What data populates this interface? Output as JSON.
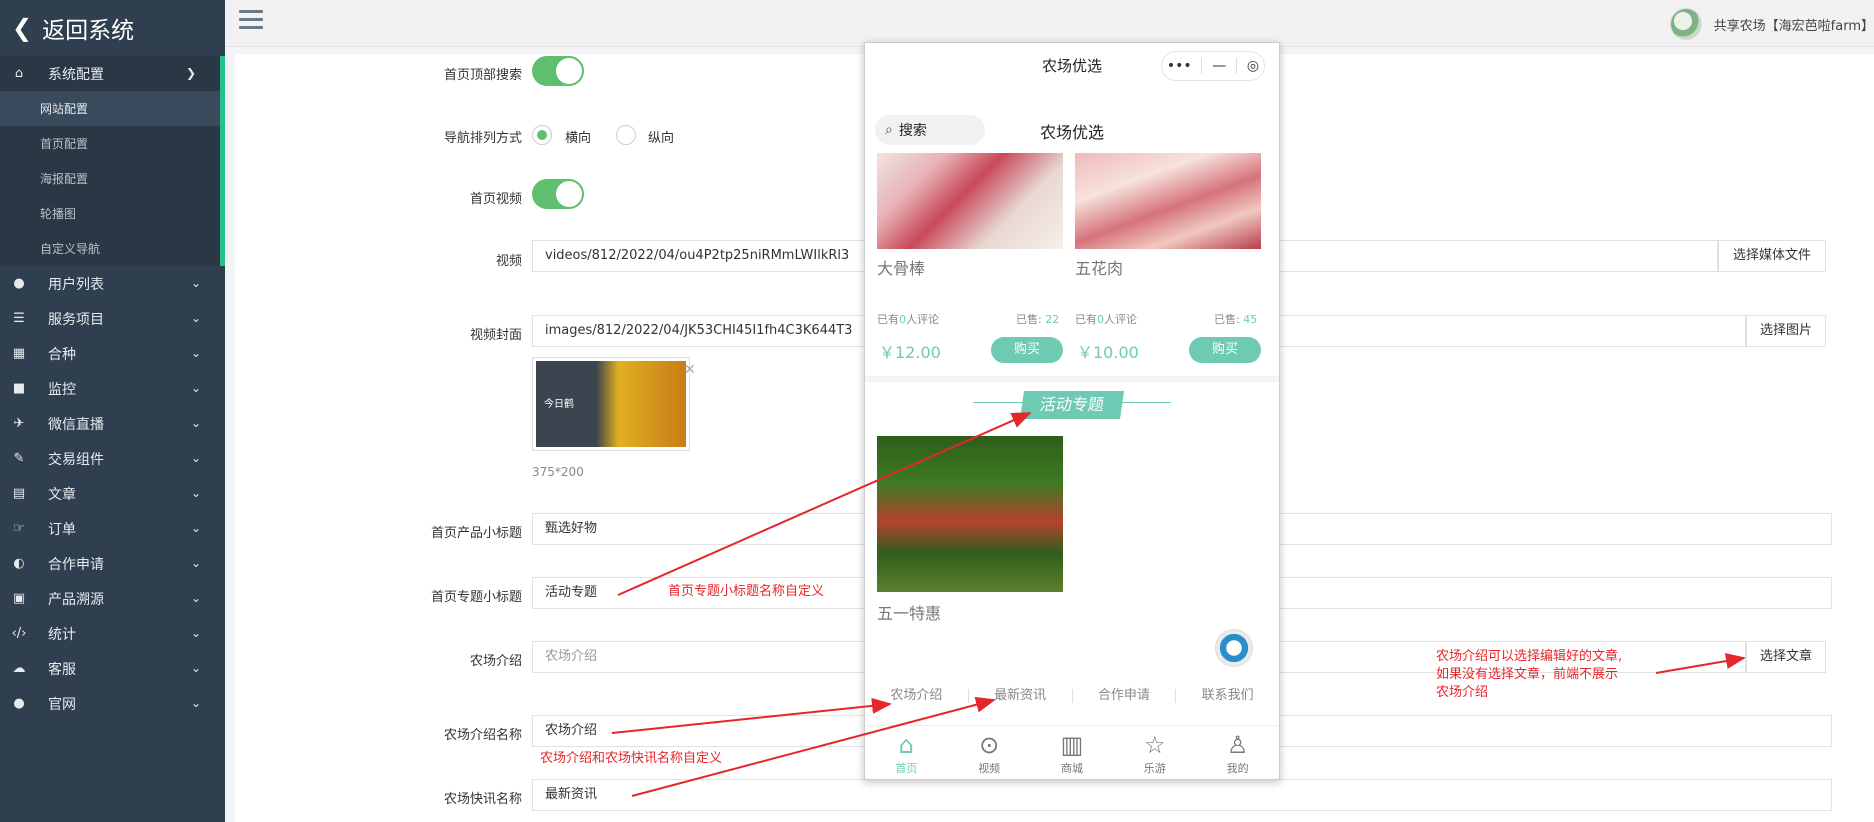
{
  "sidebar": {
    "brand": "返回系统",
    "menu": [
      {
        "label": "系统配置",
        "icon": "⌂"
      },
      {
        "label": "用户列表",
        "icon": "●"
      },
      {
        "label": "服务项目",
        "icon": "☰"
      },
      {
        "label": "合种",
        "icon": "▦"
      },
      {
        "label": "监控",
        "icon": "■"
      },
      {
        "label": "微信直播",
        "icon": "✈"
      },
      {
        "label": "交易组件",
        "icon": "✎"
      },
      {
        "label": "文章",
        "icon": "▤"
      },
      {
        "label": "订单",
        "icon": "☞"
      },
      {
        "label": "合作申请",
        "icon": "◐"
      },
      {
        "label": "产品溯源",
        "icon": "▣"
      },
      {
        "label": "统计",
        "icon": "‹/›"
      },
      {
        "label": "客服",
        "icon": "☁"
      },
      {
        "label": "官网",
        "icon": "●"
      }
    ],
    "submenu": [
      "网站配置",
      "首页配置",
      "海报配置",
      "轮播图",
      "自定义导航"
    ]
  },
  "topbar": {
    "user_name": "共享农场【海宏芭啦farm】"
  },
  "form": {
    "search_label": "首页顶部搜索",
    "nav_label": "导航排列方式",
    "nav_opt_h": "横向",
    "nav_opt_v": "纵向",
    "video_switch_label": "首页视频",
    "video_label": "视频",
    "video_value": "videos/812/2022/04/ou4P2tp25niRMmLWIlkRl3",
    "video_btn": "选择媒体文件",
    "cover_label": "视频封面",
    "cover_value": "images/812/2022/04/JK53CHI45I1fh4C3K644T3",
    "cover_btn": "选择图片",
    "cover_size": "375*200",
    "product_sub_label": "首页产品小标题",
    "product_sub_value": "甄选好物",
    "topic_sub_label": "首页专题小标题",
    "topic_sub_value": "活动专题",
    "farm_intro_label": "农场介绍",
    "farm_intro_placeholder": "农场介绍",
    "farm_intro_btn": "选择文章",
    "farm_intro_name_label": "农场介绍名称",
    "farm_intro_name_value": "农场介绍",
    "farm_news_name_label": "农场快讯名称",
    "farm_news_name_value": "最新资讯"
  },
  "annotations": {
    "topic": "首页专题小标题名称自定义",
    "intro_line1": "农场介绍可以选择编辑好的文章,",
    "intro_line2": "如果没有选择文章，前端不展示",
    "intro_line3": "农场介绍",
    "names": "农场介绍和农场快讯名称自定义"
  },
  "colors": {
    "accent": "#6fcab3",
    "sidebar_bg": "#2f3f4f",
    "annotation": "#e5262a"
  },
  "phone": {
    "title": "农场优选",
    "search": "搜索",
    "subtitle": "农场优选",
    "products": [
      {
        "name": "大骨棒",
        "comments": "0",
        "sold": "22",
        "price": "￥12.00",
        "buy": "购买"
      },
      {
        "name": "五花肉",
        "comments": "0",
        "sold": "45",
        "price": "￥10.00",
        "buy": "购买"
      }
    ],
    "meta_prefix": "已有",
    "meta_suffix": "人评论",
    "sold_prefix": "已售:",
    "topic_tag": "活动专题",
    "topic_item": "五一特惠",
    "tabs": [
      "农场介绍",
      "最新资讯",
      "合作申请",
      "联系我们"
    ],
    "tabbar": [
      {
        "label": "首页",
        "icon": "⌂"
      },
      {
        "label": "视频",
        "icon": "⊙"
      },
      {
        "label": "商城",
        "icon": "▥"
      },
      {
        "label": "乐游",
        "icon": "☆"
      },
      {
        "label": "我的",
        "icon": "♙"
      }
    ]
  }
}
